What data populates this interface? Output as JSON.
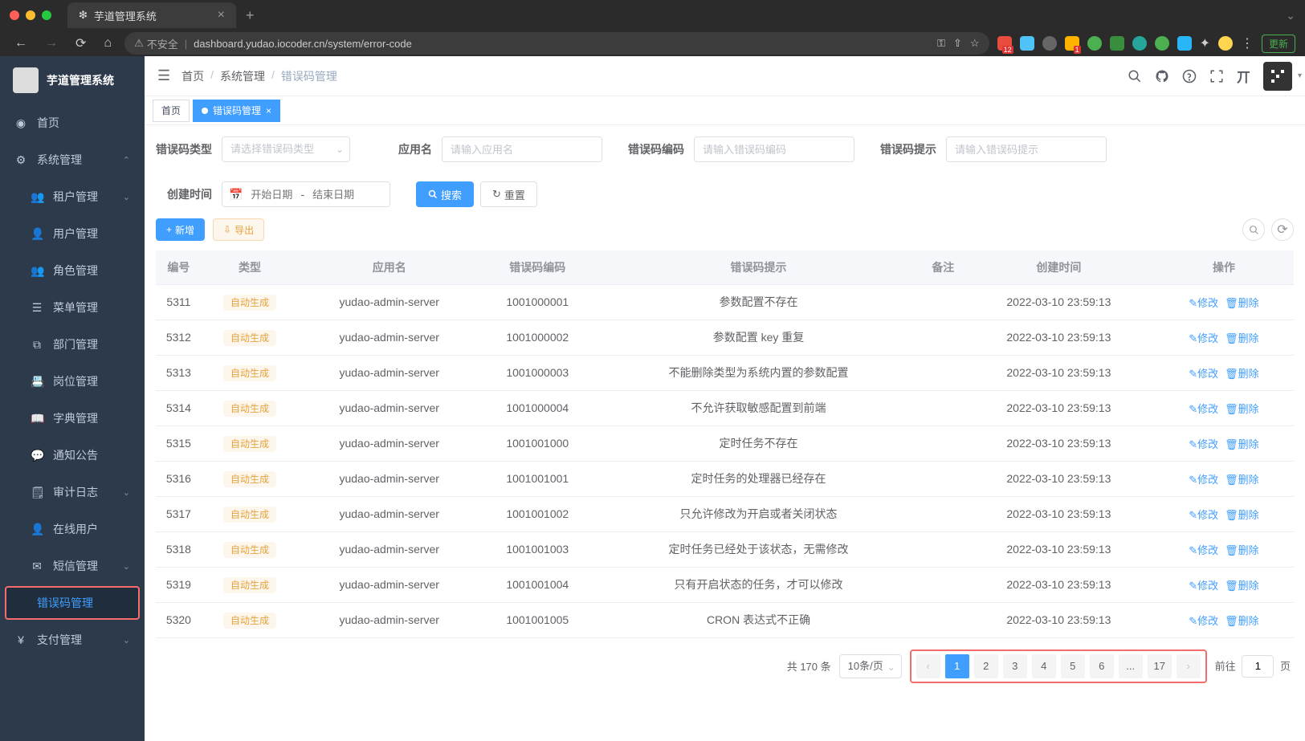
{
  "browser": {
    "tab_title": "芋道管理系统",
    "insecure_label": "不安全",
    "url": "dashboard.yudao.iocoder.cn/system/error-code",
    "update_btn": "更新"
  },
  "app_title": "芋道管理系统",
  "sidebar": [
    {
      "icon": "◉",
      "label": "首页",
      "sub": false,
      "chev": false
    },
    {
      "icon": "⚙",
      "label": "系统管理",
      "sub": false,
      "chev": true,
      "open": true
    },
    {
      "icon": "👥",
      "label": "租户管理",
      "sub": true,
      "chev": true
    },
    {
      "icon": "👤",
      "label": "用户管理",
      "sub": true
    },
    {
      "icon": "👥",
      "label": "角色管理",
      "sub": true
    },
    {
      "icon": "☰",
      "label": "菜单管理",
      "sub": true
    },
    {
      "icon": "⧉",
      "label": "部门管理",
      "sub": true
    },
    {
      "icon": "📇",
      "label": "岗位管理",
      "sub": true
    },
    {
      "icon": "📖",
      "label": "字典管理",
      "sub": true
    },
    {
      "icon": "💬",
      "label": "通知公告",
      "sub": true
    },
    {
      "icon": "🗒",
      "label": "审计日志",
      "sub": true,
      "chev": true
    },
    {
      "icon": "👤",
      "label": "在线用户",
      "sub": true
    },
    {
      "icon": "✉",
      "label": "短信管理",
      "sub": true,
      "chev": true
    },
    {
      "icon": "</>",
      "label": "错误码管理",
      "sub": true,
      "active": true,
      "highlighted": true
    },
    {
      "icon": "¥",
      "label": "支付管理",
      "sub": false,
      "chev": true
    }
  ],
  "breadcrumb": {
    "home": "首页",
    "mid": "系统管理",
    "cur": "错误码管理"
  },
  "tabs": {
    "home": "首页",
    "active": "错误码管理"
  },
  "search": {
    "type_label": "错误码类型",
    "type_ph": "请选择错误码类型",
    "app_label": "应用名",
    "app_ph": "请输入应用名",
    "code_label": "错误码编码",
    "code_ph": "请输入错误码编码",
    "msg_label": "错误码提示",
    "msg_ph": "请输入错误码提示",
    "date_label": "创建时间",
    "date_start_ph": "开始日期",
    "date_end_ph": "结束日期",
    "date_sep": "-",
    "search_btn": "搜索",
    "reset_btn": "重置"
  },
  "actions": {
    "add": "新增",
    "export": "导出",
    "edit": "修改",
    "delete": "删除"
  },
  "table": {
    "headers": [
      "编号",
      "类型",
      "应用名",
      "错误码编码",
      "错误码提示",
      "备注",
      "创建时间",
      "操作"
    ],
    "type_tag": "自动生成",
    "rows": [
      {
        "id": "5311",
        "app": "yudao-admin-server",
        "code": "1001000001",
        "msg": "参数配置不存在",
        "note": "",
        "time": "2022-03-10 23:59:13"
      },
      {
        "id": "5312",
        "app": "yudao-admin-server",
        "code": "1001000002",
        "msg": "参数配置 key 重复",
        "note": "",
        "time": "2022-03-10 23:59:13"
      },
      {
        "id": "5313",
        "app": "yudao-admin-server",
        "code": "1001000003",
        "msg": "不能删除类型为系统内置的参数配置",
        "note": "",
        "time": "2022-03-10 23:59:13"
      },
      {
        "id": "5314",
        "app": "yudao-admin-server",
        "code": "1001000004",
        "msg": "不允许获取敏感配置到前端",
        "note": "",
        "time": "2022-03-10 23:59:13"
      },
      {
        "id": "5315",
        "app": "yudao-admin-server",
        "code": "1001001000",
        "msg": "定时任务不存在",
        "note": "",
        "time": "2022-03-10 23:59:13"
      },
      {
        "id": "5316",
        "app": "yudao-admin-server",
        "code": "1001001001",
        "msg": "定时任务的处理器已经存在",
        "note": "",
        "time": "2022-03-10 23:59:13"
      },
      {
        "id": "5317",
        "app": "yudao-admin-server",
        "code": "1001001002",
        "msg": "只允许修改为开启或者关闭状态",
        "note": "",
        "time": "2022-03-10 23:59:13"
      },
      {
        "id": "5318",
        "app": "yudao-admin-server",
        "code": "1001001003",
        "msg": "定时任务已经处于该状态，无需修改",
        "note": "",
        "time": "2022-03-10 23:59:13"
      },
      {
        "id": "5319",
        "app": "yudao-admin-server",
        "code": "1001001004",
        "msg": "只有开启状态的任务，才可以修改",
        "note": "",
        "time": "2022-03-10 23:59:13"
      },
      {
        "id": "5320",
        "app": "yudao-admin-server",
        "code": "1001001005",
        "msg": "CRON 表达式不正确",
        "note": "",
        "time": "2022-03-10 23:59:13"
      }
    ]
  },
  "pagination": {
    "total_text": "共 170 条",
    "per_page": "10条/页",
    "pages": [
      "1",
      "2",
      "3",
      "4",
      "5",
      "6",
      "...",
      "17"
    ],
    "current": "1",
    "jump_prefix": "前往",
    "jump_suffix": "页",
    "jump_value": "1"
  }
}
